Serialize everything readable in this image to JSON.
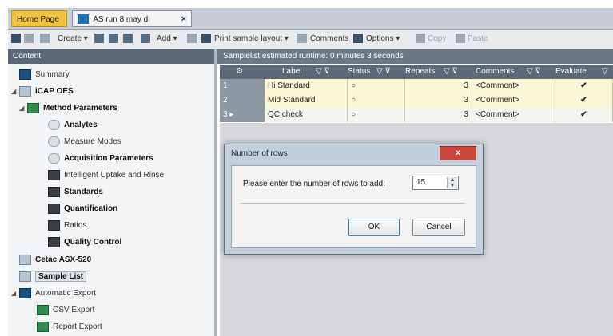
{
  "tabs": {
    "home": "Home Page",
    "document": "AS run 8 may d",
    "close": "×"
  },
  "toolbar": {
    "create": "Create ▾",
    "add": "Add ▾",
    "print_layout": "Print sample layout ▾",
    "comments": "Comments",
    "options": "Options ▾",
    "copy": "Copy",
    "paste": "Paste"
  },
  "left_pane": {
    "header": "Content",
    "items": [
      {
        "label": "Summary"
      },
      {
        "label": "iCAP OES"
      },
      {
        "label": "Method Parameters"
      },
      {
        "label": "Analytes"
      },
      {
        "label": "Measure Modes"
      },
      {
        "label": "Acquisition Parameters"
      },
      {
        "label": "Intelligent Uptake and Rinse"
      },
      {
        "label": "Standards"
      },
      {
        "label": "Quantification"
      },
      {
        "label": "Ratios"
      },
      {
        "label": "Quality Control"
      },
      {
        "label": "Cetac ASX-520"
      },
      {
        "label": "Sample List"
      },
      {
        "label": "Automatic Export"
      },
      {
        "label": "CSV Export"
      },
      {
        "label": "Report Export"
      }
    ]
  },
  "grid": {
    "banner": "Samplelist estimated runtime: 0 minutes 3 seconds",
    "columns": [
      "Label",
      "Status",
      "Repeats",
      "Comments",
      "Evaluate"
    ],
    "rows": [
      {
        "num": "1",
        "label": "Hi Standard",
        "status": "○",
        "repeats": "3",
        "comments": "<Comment>",
        "evaluate": "✔"
      },
      {
        "num": "2",
        "label": "Mid Standard",
        "status": "○",
        "repeats": "3",
        "comments": "<Comment>",
        "evaluate": "✔"
      },
      {
        "num": "3",
        "label": "QC check",
        "status": "○",
        "repeats": "3",
        "comments": "<Comment>",
        "evaluate": "✔"
      }
    ]
  },
  "dialog": {
    "title": "Number of rows",
    "close": "x",
    "prompt": "Please enter the number of rows to add:",
    "value": "15",
    "ok": "OK",
    "cancel": "Cancel"
  }
}
